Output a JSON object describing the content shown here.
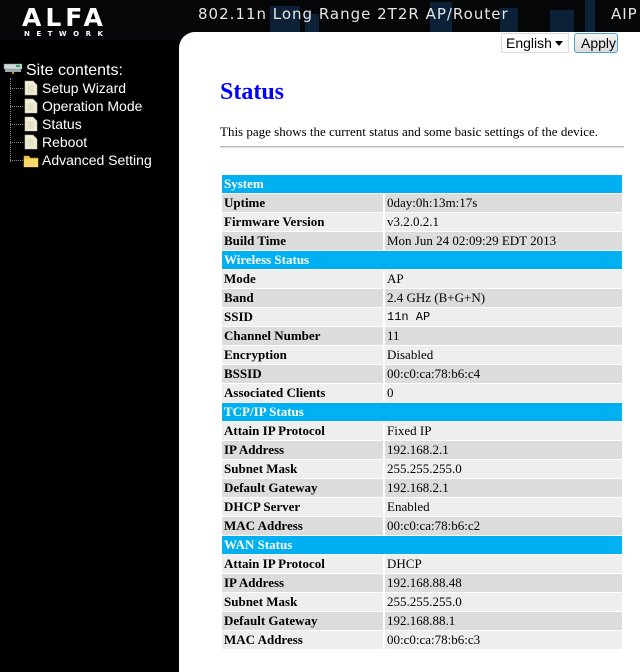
{
  "header": {
    "brand": "ALFA",
    "brand_sub": "NETWORK",
    "product_title": "802.11n Long Range 2T2R AP/Router",
    "product_right": "AIP"
  },
  "sidebar": {
    "title": "Site contents:",
    "items": [
      {
        "label": "Setup Wizard",
        "icon": "page-icon"
      },
      {
        "label": "Operation Mode",
        "icon": "page-icon"
      },
      {
        "label": "Status",
        "icon": "page-icon"
      },
      {
        "label": "Reboot",
        "icon": "page-icon"
      },
      {
        "label": "Advanced Setting",
        "icon": "folder-icon"
      }
    ]
  },
  "toolbar": {
    "language_selected": "English",
    "apply_label": "Apply"
  },
  "page": {
    "title": "Status",
    "description": "This page shows the current status and some basic settings of the device."
  },
  "sections": [
    {
      "title": "System",
      "rows": [
        {
          "label": "Uptime",
          "value": "0day:0h:13m:17s"
        },
        {
          "label": "Firmware Version",
          "value": "v3.2.0.2.1"
        },
        {
          "label": "Build Time",
          "value": "Mon Jun 24 02:09:29 EDT 2013"
        }
      ]
    },
    {
      "title": "Wireless Status",
      "rows": [
        {
          "label": "Mode",
          "value": "AP"
        },
        {
          "label": "Band",
          "value": "2.4 GHz (B+G+N)"
        },
        {
          "label": "SSID",
          "value": "11n AP"
        },
        {
          "label": "Channel Number",
          "value": "11"
        },
        {
          "label": "Encryption",
          "value": "Disabled"
        },
        {
          "label": "BSSID",
          "value": "00:c0:ca:78:b6:c4"
        },
        {
          "label": "Associated Clients",
          "value": "0"
        }
      ]
    },
    {
      "title": "TCP/IP Status",
      "rows": [
        {
          "label": "Attain IP Protocol",
          "value": "Fixed IP"
        },
        {
          "label": "IP Address",
          "value": "192.168.2.1"
        },
        {
          "label": "Subnet Mask",
          "value": "255.255.255.0"
        },
        {
          "label": "Default Gateway",
          "value": "192.168.2.1"
        },
        {
          "label": "DHCP Server",
          "value": "Enabled"
        },
        {
          "label": "MAC Address",
          "value": "00:c0:ca:78:b6:c2"
        }
      ]
    },
    {
      "title": "WAN Status",
      "rows": [
        {
          "label": "Attain IP Protocol",
          "value": "DHCP"
        },
        {
          "label": "IP Address",
          "value": "192.168.88.48"
        },
        {
          "label": "Subnet Mask",
          "value": "255.255.255.0"
        },
        {
          "label": "Default Gateway",
          "value": "192.168.88.1"
        },
        {
          "label": "MAC Address",
          "value": "00:c0:ca:78:b6:c3"
        }
      ]
    }
  ],
  "colors": {
    "section_header": "#00b0f0",
    "title": "#0000ff",
    "row_even": "#dcdcdc",
    "row_odd": "#eeeeee"
  }
}
